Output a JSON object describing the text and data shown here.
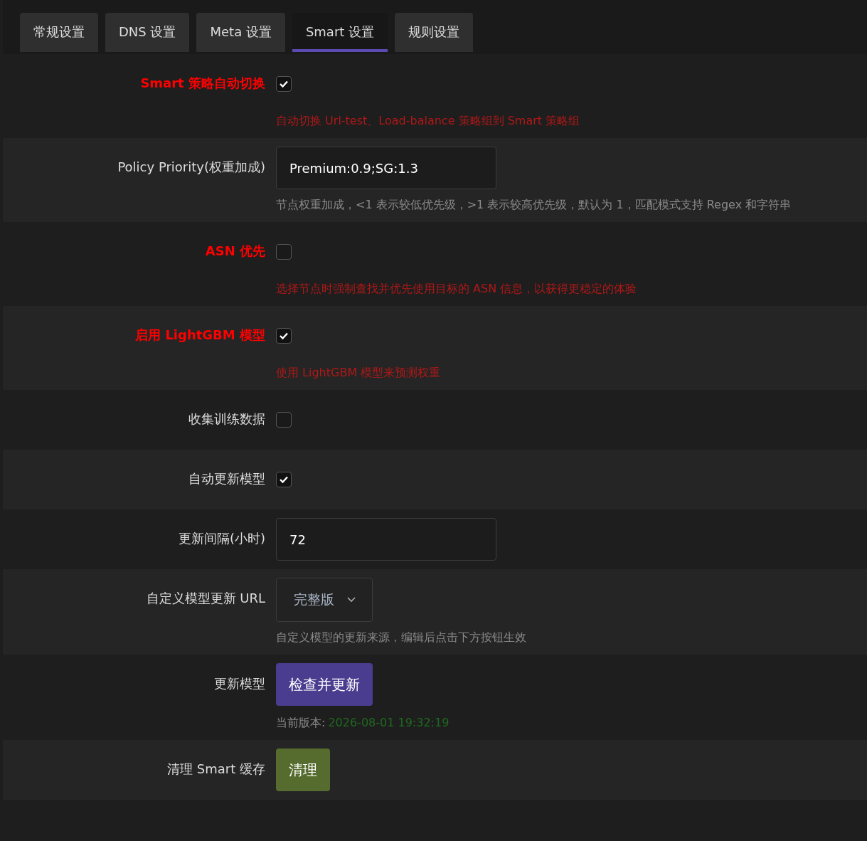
{
  "tabs": [
    {
      "label": "常规设置",
      "selected": false
    },
    {
      "label": "DNS 设置",
      "selected": false
    },
    {
      "label": "Meta 设置",
      "selected": false
    },
    {
      "label": "Smart 设置",
      "selected": true
    },
    {
      "label": "规则设置",
      "selected": false
    }
  ],
  "rows": [
    {
      "kind": "checkbox",
      "label": "Smart 策略自动切换",
      "highlight": true,
      "checked": true,
      "description": "自动切换 Url-test、Load-balance 策略组到 Smart 策略组"
    },
    {
      "kind": "text",
      "label": "Policy Priority(权重加成)",
      "highlight": false,
      "value": "Premium:0.9;SG:1.3",
      "description": "节点权重加成，<1 表示较低优先级，>1 表示较高优先级，默认为 1，匹配模式支持 Regex 和字符串"
    },
    {
      "kind": "checkbox",
      "label": "ASN 优先",
      "highlight": true,
      "checked": false,
      "description": "选择节点时强制查找并优先使用目标的 ASN 信息，以获得更稳定的体验"
    },
    {
      "kind": "checkbox",
      "label": "启用 LightGBM 模型",
      "highlight": true,
      "checked": true,
      "description": "使用 LightGBM 模型来预测权重"
    },
    {
      "kind": "checkbox",
      "label": "收集训练数据",
      "highlight": false,
      "checked": false
    },
    {
      "kind": "checkbox",
      "label": "自动更新模型",
      "highlight": false,
      "checked": true
    },
    {
      "kind": "text",
      "label": "更新间隔(小时)",
      "highlight": false,
      "value": "72"
    },
    {
      "kind": "select",
      "label": "自定义模型更新 URL",
      "highlight": false,
      "value": "完整版",
      "description": "自定义模型的更新来源，编辑后点击下方按钮生效"
    },
    {
      "kind": "button",
      "label": "更新模型",
      "highlight": false,
      "button": "检查并更新",
      "color": "#4a3c8e",
      "version_label": "当前版本:",
      "version_value": "2026-08-01 19:32:19"
    },
    {
      "kind": "button",
      "label": "清理 Smart 缓存",
      "highlight": false,
      "button": "清理",
      "color": "#566b2e"
    }
  ]
}
